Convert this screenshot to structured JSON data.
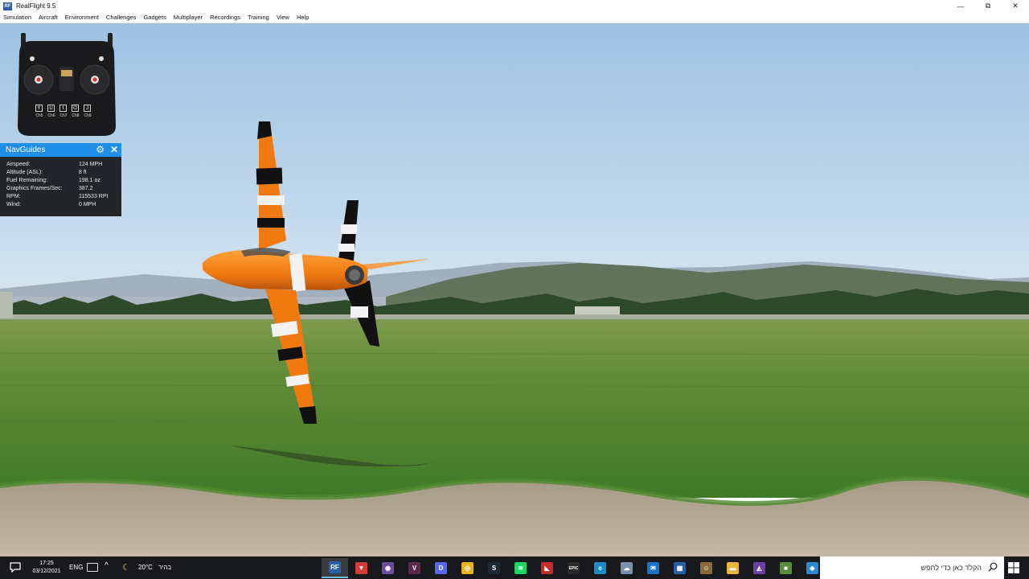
{
  "window": {
    "title": "RealFlight 9.5",
    "app_icon": "RF",
    "controls": {
      "minimize": "—",
      "maximize": "⧉",
      "close": "✕"
    }
  },
  "menu": [
    {
      "label": "Simulation"
    },
    {
      "label": "Aircraft"
    },
    {
      "label": "Environment"
    },
    {
      "label": "Challenges"
    },
    {
      "label": "Gadgets"
    },
    {
      "label": "Multiplayer"
    },
    {
      "label": "Recordings"
    },
    {
      "label": "Training"
    },
    {
      "label": "View"
    },
    {
      "label": "Help"
    }
  ],
  "transmitter": {
    "switches": [
      "Y",
      "U",
      "I",
      "O",
      "J"
    ],
    "channels": [
      "Ch5",
      "Ch6",
      "Ch7",
      "Ch8",
      "Ch9"
    ]
  },
  "navguides": {
    "title": "NavGuides",
    "gear_icon": "⚙",
    "close_icon": "✕",
    "rows": [
      {
        "label": "Airspeed:",
        "value": "124 MPH"
      },
      {
        "label": "Altitude (ASL):",
        "value": "8 ft"
      },
      {
        "label": "Fuel Remaining:",
        "value": "198.1 oz"
      },
      {
        "label": "Graphics Frames/Sec:",
        "value": "387.2"
      },
      {
        "label": "RPM:",
        "value": "115533 RPI"
      },
      {
        "label": "Wind:",
        "value": "0 MPH"
      }
    ]
  },
  "taskbar": {
    "time": "17:25",
    "date": "03/12/2021",
    "language": "ENG",
    "temperature": "20°C",
    "condition": "בהיר",
    "search_placeholder": "הקלד כאן כדי לחפש",
    "apps": [
      {
        "name": "realflight",
        "color": "#2b5fa8",
        "glyph": "RF",
        "active": true
      },
      {
        "name": "app-red",
        "color": "#d33b3b",
        "glyph": "▼"
      },
      {
        "name": "app-davinci",
        "color": "#6a4b9c",
        "glyph": "◉"
      },
      {
        "name": "app-resolve",
        "color": "#5a2a4a",
        "glyph": "V"
      },
      {
        "name": "discord",
        "color": "#5865f2",
        "glyph": "D"
      },
      {
        "name": "chrome",
        "color": "#e8b41b",
        "glyph": "◎"
      },
      {
        "name": "steam",
        "color": "#1b2838",
        "glyph": "S"
      },
      {
        "name": "spotify",
        "color": "#1ed760",
        "glyph": "≋"
      },
      {
        "name": "app-flag",
        "color": "#c82a2a",
        "glyph": "◣"
      },
      {
        "name": "epic-games",
        "color": "#2a2a2a",
        "glyph": "EPIC"
      },
      {
        "name": "edge",
        "color": "#1d8ac9",
        "glyph": "e"
      },
      {
        "name": "app-cloud",
        "color": "#7a8fa8",
        "glyph": "☁"
      },
      {
        "name": "mail",
        "color": "#1a73c7",
        "glyph": "✉"
      },
      {
        "name": "store",
        "color": "#2a5caa",
        "glyph": "▦"
      },
      {
        "name": "app-people",
        "color": "#8a6a3a",
        "glyph": "☺"
      },
      {
        "name": "file-explorer",
        "color": "#e8b63a",
        "glyph": "▬"
      },
      {
        "name": "app-visualstudio",
        "color": "#6a3fa8",
        "glyph": "◭"
      },
      {
        "name": "minecraft",
        "color": "#5a8a3a",
        "glyph": "■"
      },
      {
        "name": "app-maps",
        "color": "#2a8ad0",
        "glyph": "◆"
      }
    ]
  }
}
